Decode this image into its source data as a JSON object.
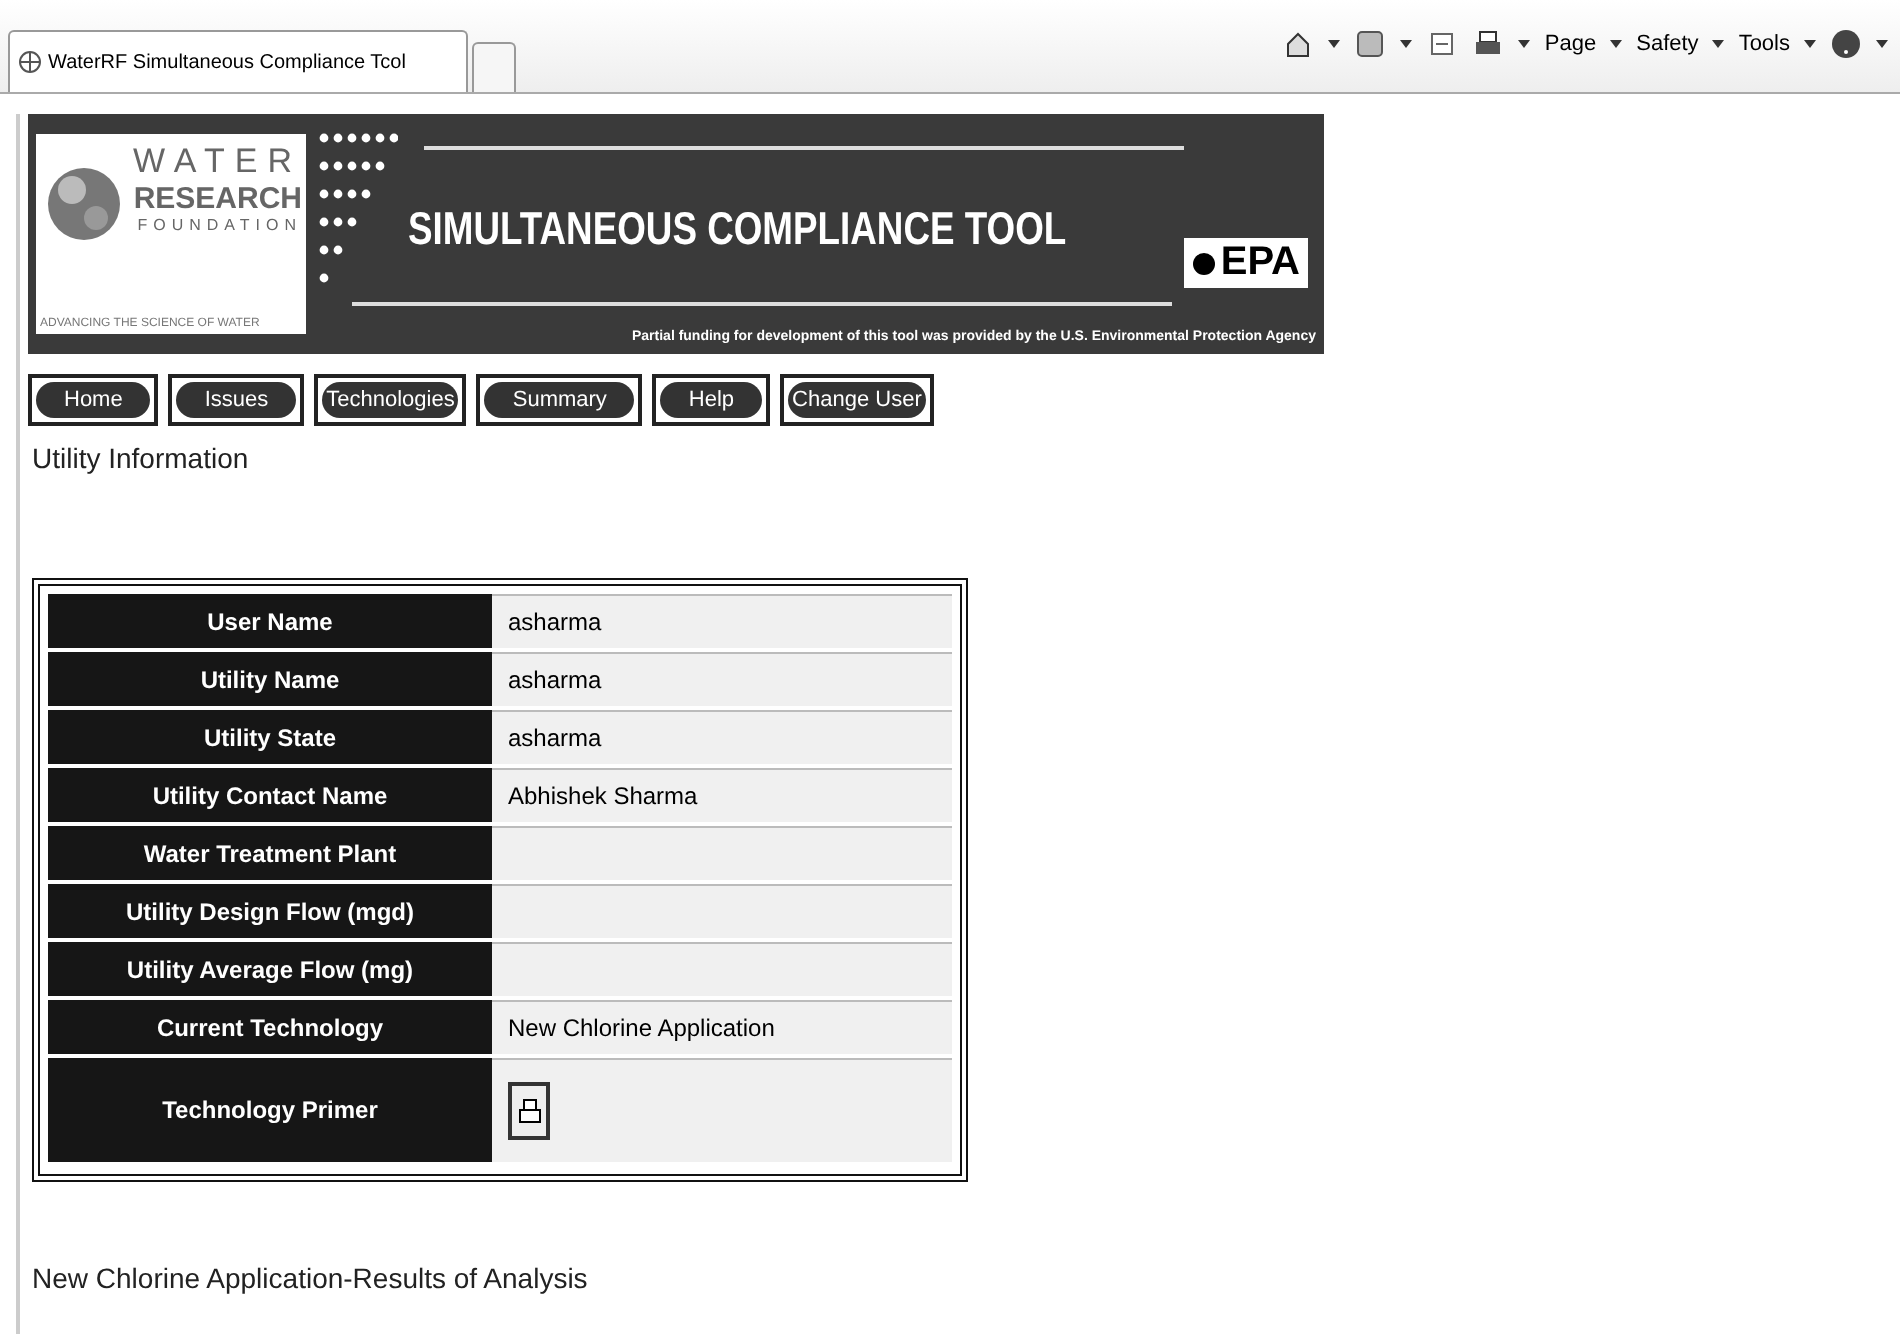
{
  "browser": {
    "tab_title": "WaterRF Simultaneous Compliance Tcol",
    "menus": [
      "Page",
      "Safety",
      "Tools"
    ]
  },
  "banner": {
    "logo_lines": [
      "WATER",
      "RESEARCH",
      "FOUNDATION",
      "ADVANCING THE SCIENCE OF WATER"
    ],
    "title": "SIMULTANEOUS COMPLIANCE TOOL",
    "agency": "EPA",
    "funding_note": "Partial funding for development of this tool was provided by the U.S. Environmental Protection Agency"
  },
  "nav": [
    "Home",
    "Issues",
    "Technologies",
    "Summary",
    "Help",
    "Change User"
  ],
  "section_title": "Utility Information",
  "info_rows": [
    {
      "label": "User Name",
      "value": "asharma",
      "kind": "text"
    },
    {
      "label": "Utility Name",
      "value": "asharma",
      "kind": "text"
    },
    {
      "label": "Utility State",
      "value": "asharma",
      "kind": "text"
    },
    {
      "label": "Utility Contact Name",
      "value": "Abhishek Sharma",
      "kind": "text"
    },
    {
      "label": "Water Treatment Plant",
      "kind": "text"
    },
    {
      "label": "Utility Design Flow (mgd)",
      "kind": "text"
    },
    {
      "label": "Utility Average Flow (mg)",
      "kind": "text"
    },
    {
      "label": "Current Technology",
      "value": "New Chlorine Application",
      "kind": "text"
    },
    {
      "label": "Technology Primer",
      "kind": "print_button"
    }
  ],
  "results_title": "New Chlorine Application-Results of Analysis"
}
